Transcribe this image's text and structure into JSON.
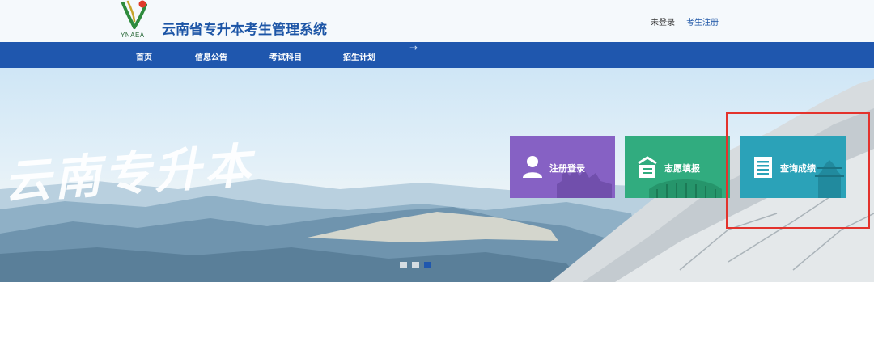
{
  "header": {
    "logo_text": "YNAEA",
    "title": "云南省专升本考生管理系统",
    "login_status": "未登录",
    "register_link": "考生注册"
  },
  "nav": {
    "items": [
      "首页",
      "信息公告",
      "考试科目",
      "招生计划"
    ],
    "arrow": "→"
  },
  "banner": {
    "calligraphy": "云南专升本",
    "tiles": [
      {
        "label": "注册登录",
        "icon": "user-icon",
        "color": "#8661c4"
      },
      {
        "label": "志愿填报",
        "icon": "form-submit-icon",
        "color": "#31ac7f"
      },
      {
        "label": "查询成绩",
        "icon": "document-list-icon",
        "color": "#2ba2b8"
      }
    ],
    "carousel": {
      "count": 3,
      "active": 3
    }
  },
  "colors": {
    "brand_blue": "#1f57ae",
    "title_blue": "#1c55a6",
    "highlight_red": "#e3322c"
  }
}
